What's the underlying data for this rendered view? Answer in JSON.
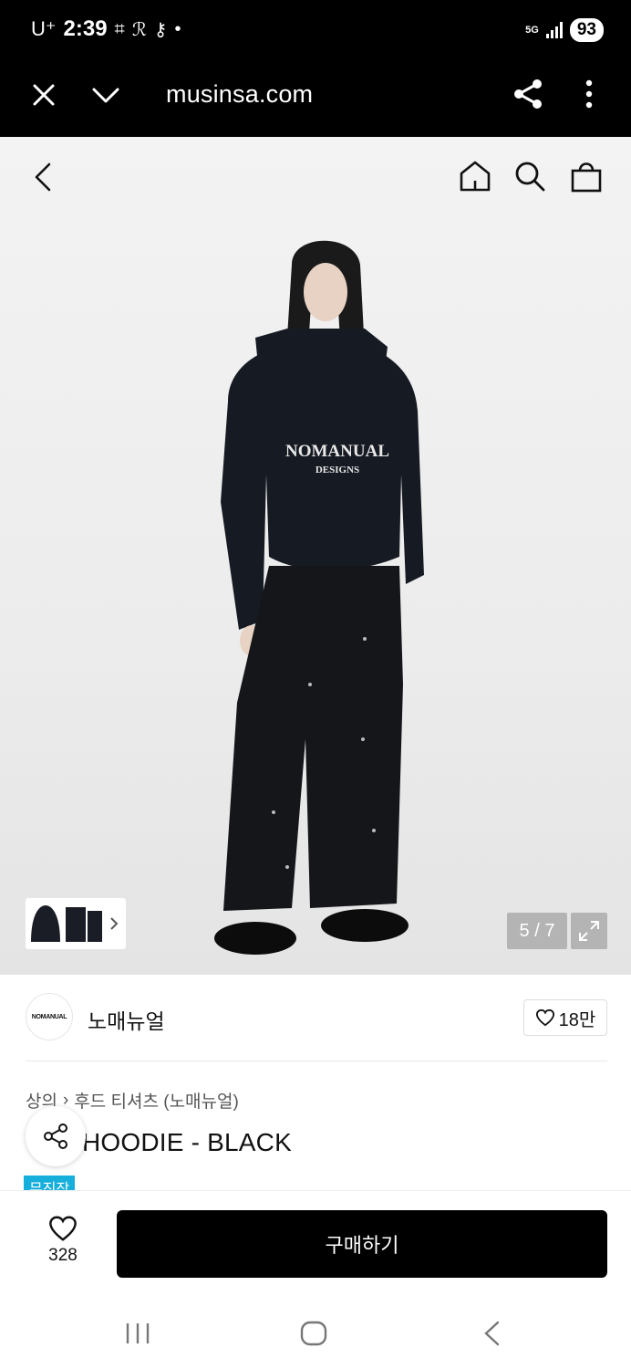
{
  "status_bar": {
    "carrier": "U⁺",
    "time": "2:39",
    "network": "5G",
    "battery": "93"
  },
  "browser": {
    "url": "musinsa.com"
  },
  "gallery": {
    "counter": "5 / 7"
  },
  "brand": {
    "logo_text": "NOMANUAL",
    "name": "노매뉴얼",
    "likes": "18만"
  },
  "product": {
    "breadcrumb": [
      "상의",
      "후드 티셔츠 (노매뉴얼)"
    ],
    "name": "HOODIE - BLACK",
    "badge": "무진장",
    "print_line1": "NOMANUAL",
    "print_line2": "DESIGNS"
  },
  "purchase": {
    "wish_count": "328",
    "buy_label": "구매하기"
  },
  "colors": {
    "accent_badge": "#16aedb",
    "bar_background": "#000000"
  }
}
